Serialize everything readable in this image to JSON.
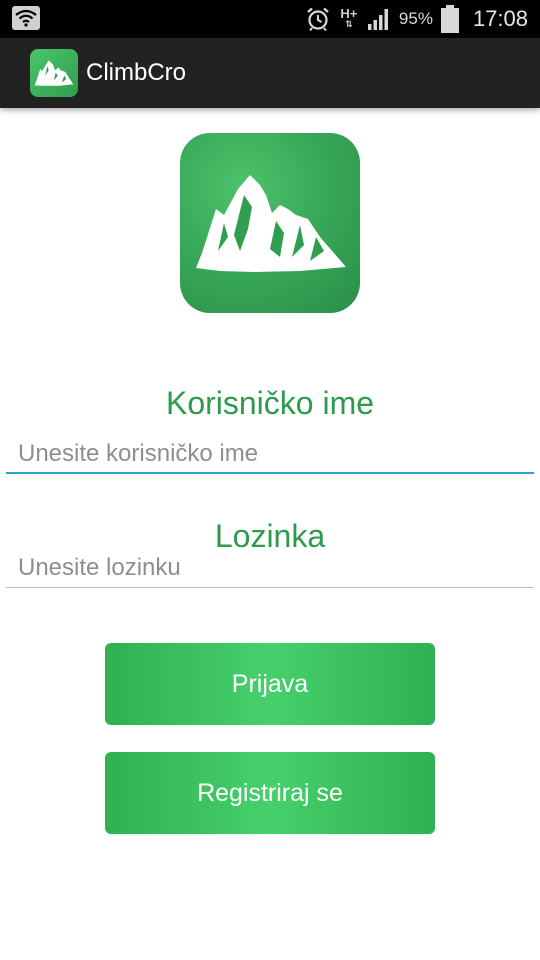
{
  "status_bar": {
    "battery_percent": "95%",
    "time": "17:08",
    "network_type": "H+",
    "icons": [
      "wifi-icon",
      "alarm-icon",
      "data-arrows-icon",
      "signal-icon",
      "battery-icon"
    ]
  },
  "action_bar": {
    "title": "ClimbCro",
    "icon": "mountain-logo-icon"
  },
  "logo": {
    "icon": "mountain-logo-icon"
  },
  "form": {
    "username_label": "Korisničko ime",
    "username_placeholder": "Unesite korisničko ime",
    "username_value": "",
    "password_label": "Lozinka",
    "password_placeholder": "Unesite lozinku",
    "password_value": ""
  },
  "buttons": {
    "login_label": "Prijava",
    "register_label": "Registriraj se"
  },
  "colors": {
    "brand_green": "#2e9a4c",
    "button_green": "#3fc262",
    "focus_underline": "#2aa6c9",
    "action_bar": "#222222",
    "status_bar": "#000000"
  }
}
